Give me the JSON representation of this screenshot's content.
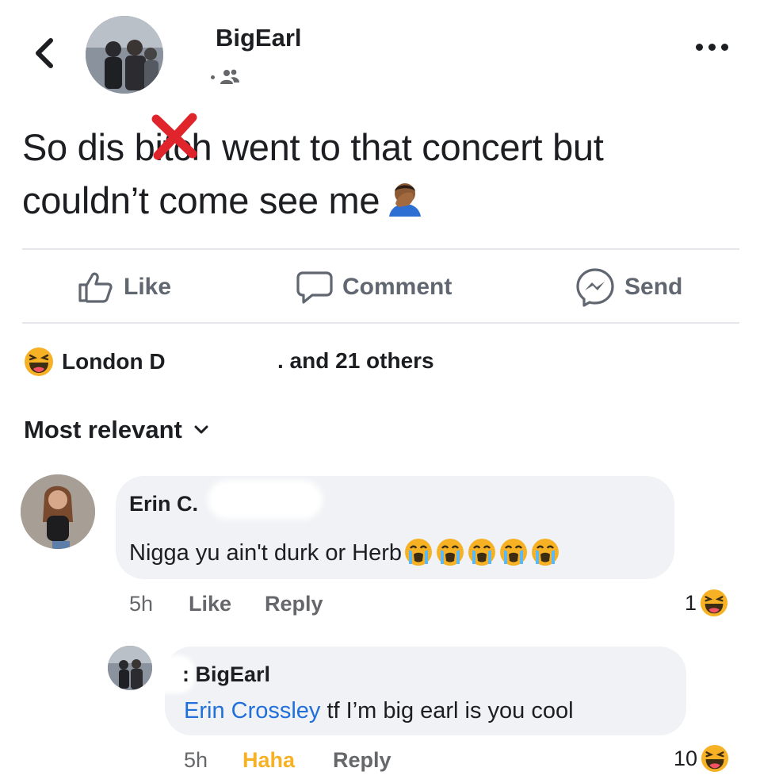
{
  "header": {
    "username": "BigEarl",
    "audience_icon": "friends-icon",
    "back_icon": "chevron-left-icon",
    "more_icon": "more-horizontal-icon"
  },
  "post": {
    "line1_before": "So dis b",
    "line1_censored": "it",
    "line1_after": "ch went to that concert but",
    "line2": "couldn’t come see me",
    "emoji": "facepalm-emoji"
  },
  "actions": {
    "like": "Like",
    "comment": "Comment",
    "send": "Send"
  },
  "reactions": {
    "icon": "haha-reaction-icon",
    "names": "London D",
    "others": ". and 21 others"
  },
  "sort": {
    "label": "Most relevant",
    "icon": "chevron-down-icon"
  },
  "comments": [
    {
      "author": "Erin C.",
      "text": "Nigga yu ain't durk or Herb",
      "emoji": "loudly-crying-face x5",
      "time": "5h",
      "like": "Like",
      "reply": "Reply",
      "reaction_count": "1",
      "reaction_icon": "haha-reaction-icon"
    },
    {
      "author": ": BigEarl",
      "mention": "Erin Crossley",
      "text": " tf I’m big earl is you cool",
      "time": "5h",
      "like": "Haha",
      "reply": "Reply",
      "reaction_count": "10",
      "reaction_icon": "haha-reaction-icon"
    }
  ],
  "colors": {
    "text": "#1c1e21",
    "secondary": "#65676b",
    "bubble": "#f0f2f5",
    "divider": "#e4e6eb",
    "mention": "#216fdb",
    "haha": "#f7b125",
    "censor_x": "#e0242b"
  }
}
